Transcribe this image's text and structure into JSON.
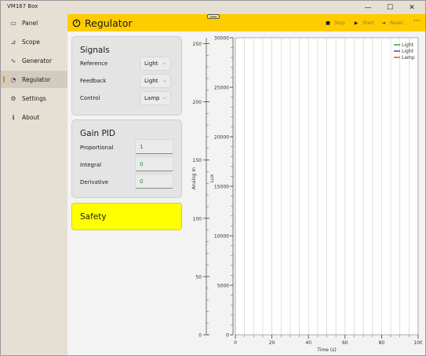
{
  "window": {
    "title": "VM167 Box",
    "minimize_glyph": "—",
    "maximize_glyph": "☐",
    "close_glyph": "✕"
  },
  "sidebar": {
    "items": [
      {
        "label": "Panel",
        "icon": "dashboard-icon",
        "glyph": "▭",
        "active": false
      },
      {
        "label": "Scope",
        "icon": "scope-chart-icon",
        "glyph": "⊿",
        "active": false
      },
      {
        "label": "Generator",
        "icon": "wave-icon",
        "glyph": "∿",
        "active": false
      },
      {
        "label": "Regulator",
        "icon": "gauge-icon",
        "glyph": "◔",
        "active": true
      },
      {
        "label": "Settings",
        "icon": "gear-icon",
        "glyph": "⚙",
        "active": false
      },
      {
        "label": "About",
        "icon": "info-icon",
        "glyph": "ℹ",
        "active": false
      }
    ]
  },
  "header": {
    "title": "Regulator",
    "accent_color": "#ffcc00",
    "actions": {
      "stop": {
        "label": "Stop",
        "glyph": "■"
      },
      "start": {
        "label": "Start",
        "glyph": "▶"
      },
      "reset": {
        "label": "Reset",
        "glyph": "⇥"
      }
    },
    "more_glyph": "···"
  },
  "signals": {
    "title": "Signals",
    "rows": [
      {
        "label": "Reference",
        "value": "Light"
      },
      {
        "label": "Feedback",
        "value": "Light"
      },
      {
        "label": "Control",
        "value": "Lamp"
      }
    ],
    "chevron_glyph": "⌵"
  },
  "gain_pid": {
    "title": "Gain PID",
    "rows": [
      {
        "label": "Proportional",
        "value": "1"
      },
      {
        "label": "Integral",
        "value": "0"
      },
      {
        "label": "Derivative",
        "value": "0"
      }
    ],
    "value_color": "#2a8a2a"
  },
  "safety": {
    "label": "Safety",
    "color": "#ffff00"
  },
  "chart_data": {
    "type": "line",
    "title": "",
    "xlabel": "Time (s)",
    "ylabel_left": "Analog In",
    "ylabel_right": "Lux",
    "xlim": [
      0,
      100
    ],
    "ylim_left": [
      0,
      255
    ],
    "ylim_right": [
      0,
      30000
    ],
    "x_ticks": [
      "0",
      "20",
      "40",
      "60",
      "80",
      "100"
    ],
    "y_left_ticks": [
      "0",
      "50",
      "100",
      "150",
      "200",
      "250"
    ],
    "y_right_ticks": [
      "0",
      "5000",
      "10000",
      "15000",
      "20000",
      "25000",
      "30000"
    ],
    "grid": true,
    "legend_position": "top-right",
    "series": [
      {
        "name": "Light",
        "color": "#2e9a3c",
        "values": []
      },
      {
        "name": "Light",
        "color": "#4a3aa8",
        "values": []
      },
      {
        "name": "Lamp",
        "color": "#e0442a",
        "values": []
      }
    ]
  }
}
